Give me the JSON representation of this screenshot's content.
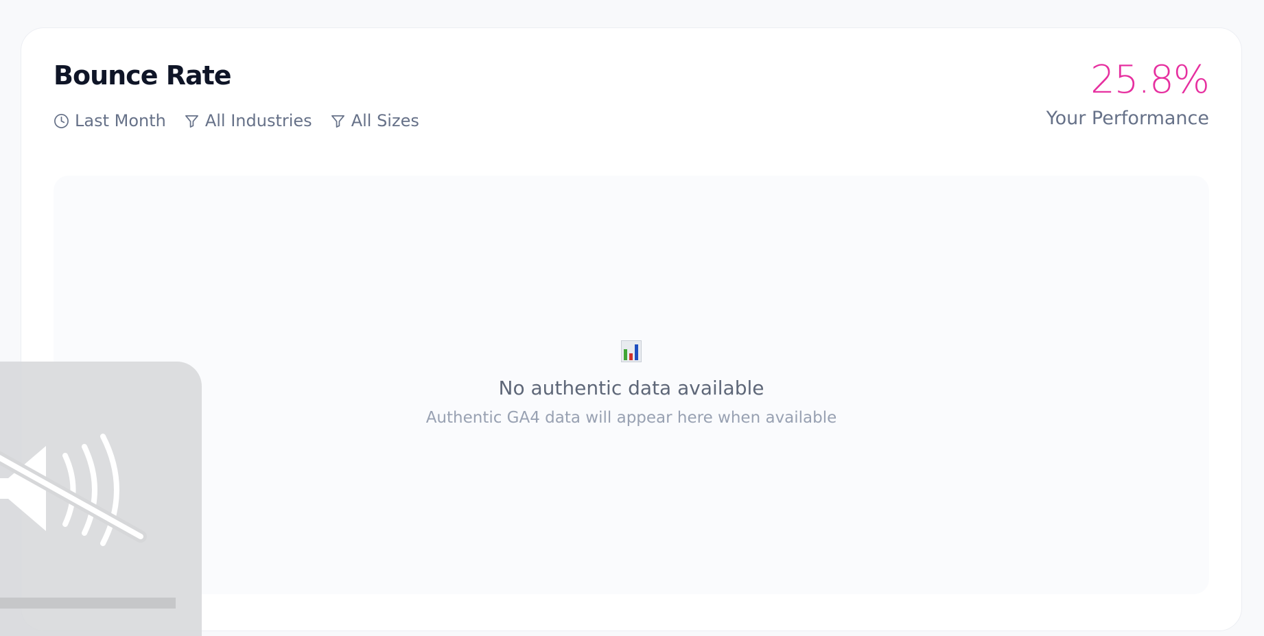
{
  "card": {
    "title": "Bounce Rate",
    "filters": [
      {
        "label": "Last Month",
        "icon": "clock-icon"
      },
      {
        "label": "All Industries",
        "icon": "filter-icon"
      },
      {
        "label": "All Sizes",
        "icon": "filter-icon"
      }
    ],
    "performance": {
      "value": "25.8%",
      "label": "Your Performance",
      "color": "#e62f9f"
    }
  },
  "chart_area": {
    "empty_state": {
      "icon": "bar-chart-emoji-icon",
      "title": "No authentic data available",
      "subtitle": "Authentic GA4 data will appear here when available"
    }
  },
  "overlay": {
    "icon": "muted-speaker-icon"
  }
}
